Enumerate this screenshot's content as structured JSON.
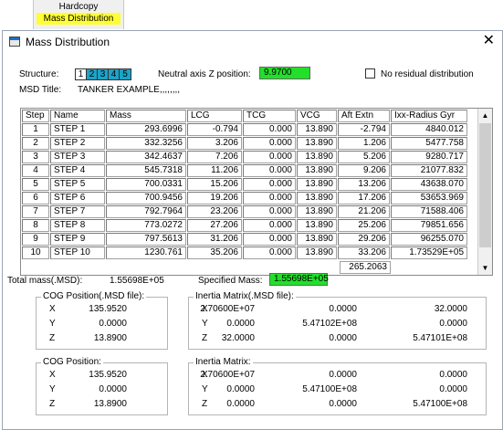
{
  "menu": {
    "hardcopy": "Hardcopy",
    "mass_distribution": "Mass Distribution"
  },
  "dialog": {
    "title": "Mass Distribution",
    "close": "✕",
    "structure_label": "Structure:",
    "structure_buttons": [
      "1",
      "2",
      "3",
      "4",
      "5"
    ],
    "neutral_axis_label": "Neutral axis Z position:",
    "neutral_axis_value": "9.9700",
    "no_residual_label": "No residual distribution",
    "msd_title_label": "MSD Title:",
    "msd_title_value": "TANKER EXAMPLE,,,,,,,,",
    "table": {
      "headers": [
        "Step",
        "Name",
        "Mass",
        "LCG",
        "TCG",
        "VCG",
        "Aft Extn",
        "Ixx-Radius Gyr"
      ],
      "rows": [
        [
          "1",
          "STEP 1",
          "293.6996",
          "-0.794",
          "0.000",
          "13.890",
          "-2.794",
          "4840.012"
        ],
        [
          "2",
          "STEP 2",
          "332.3256",
          "3.206",
          "0.000",
          "13.890",
          "1.206",
          "5477.758"
        ],
        [
          "3",
          "STEP 3",
          "342.4637",
          "7.206",
          "0.000",
          "13.890",
          "5.206",
          "9280.717"
        ],
        [
          "4",
          "STEP 4",
          "545.7318",
          "11.206",
          "0.000",
          "13.890",
          "9.206",
          "21077.832"
        ],
        [
          "5",
          "STEP 5",
          "700.0331",
          "15.206",
          "0.000",
          "13.890",
          "13.206",
          "43638.070"
        ],
        [
          "6",
          "STEP 6",
          "700.9456",
          "19.206",
          "0.000",
          "13.890",
          "17.206",
          "53653.969"
        ],
        [
          "7",
          "STEP 7",
          "792.7964",
          "23.206",
          "0.000",
          "13.890",
          "21.206",
          "71588.406"
        ],
        [
          "8",
          "STEP 8",
          "773.0272",
          "27.206",
          "0.000",
          "13.890",
          "25.206",
          "79851.656"
        ],
        [
          "9",
          "STEP 9",
          "797.5613",
          "31.206",
          "0.000",
          "13.890",
          "29.206",
          "96255.070"
        ],
        [
          "10",
          "STEP 10",
          "1230.761",
          "35.206",
          "0.000",
          "13.890",
          "33.206",
          "1.73529E+05"
        ]
      ],
      "extra_aft_extn": "265.2063"
    },
    "total_mass_label": "Total mass(.MSD):",
    "total_mass_value": "1.55698E+05",
    "specified_mass_label": "Specified Mass:",
    "specified_mass_value": "1.55698E+05",
    "cog_msd": {
      "title": "COG Position(.MSD file):",
      "x_label": "X",
      "y_label": "Y",
      "z_label": "Z",
      "x": "135.9520",
      "y": "0.0000",
      "z": "13.8900"
    },
    "inertia_msd": {
      "title": "Inertia Matrix(.MSD file):",
      "x_label": "X",
      "y_label": "Y",
      "z_label": "Z",
      "rows": [
        [
          "2.70600E+07",
          "0.0000",
          "32.0000"
        ],
        [
          "0.0000",
          "5.47102E+08",
          "0.0000"
        ],
        [
          "32.0000",
          "0.0000",
          "5.47101E+08"
        ]
      ]
    },
    "cog": {
      "title": "COG Position:",
      "x_label": "X",
      "y_label": "Y",
      "z_label": "Z",
      "x": "135.9520",
      "y": "0.0000",
      "z": "13.8900"
    },
    "inertia": {
      "title": "Inertia Matrix:",
      "x_label": "X",
      "y_label": "Y",
      "z_label": "Z",
      "rows": [
        [
          "2.70600E+07",
          "0.0000",
          "0.0000"
        ],
        [
          "0.0000",
          "5.47100E+08",
          "0.0000"
        ],
        [
          "0.0000",
          "0.0000",
          "5.47100E+08"
        ]
      ]
    }
  },
  "colors": {
    "highlight_yellow": "#ffff33",
    "green_field": "#22e02a",
    "structure_button": "#1ca3c6"
  }
}
